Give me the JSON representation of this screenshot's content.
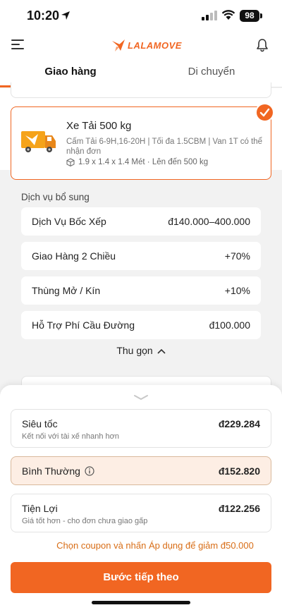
{
  "status_bar": {
    "time": "10:20",
    "battery": "98"
  },
  "header": {
    "logo_text": "LALAMOVE",
    "brand_color": "#f16622"
  },
  "tabs": [
    {
      "label": "Giao hàng",
      "active": true
    },
    {
      "label": "Di chuyển",
      "active": false
    }
  ],
  "vehicle": {
    "title": "Xe Tải 500 kg",
    "description": "Cấm Tải 6-9H,16-20H | Tối đa 1.5CBM | Van 1T có thể nhận đơn",
    "dimensions": "1.9 x 1.4 x 1.4 Mét · Lên đến 500 kg",
    "selected": true
  },
  "services": {
    "title": "Dịch vụ bổ sung",
    "items": [
      {
        "name": "Dịch Vụ Bốc Xếp",
        "price": "đ140.000–400.000"
      },
      {
        "name": "Giao Hàng 2 Chiều",
        "price": "+70%"
      },
      {
        "name": "Thùng Mở / Kín",
        "price": "+10%"
      },
      {
        "name": "Hỗ Trợ Phí Cầu Đường",
        "price": "đ100.000"
      }
    ],
    "collapse_label": "Thu gọn"
  },
  "delivery_options": [
    {
      "name": "Siêu tốc",
      "price": "đ229.284",
      "subtitle": "Kết nối với tài xế nhanh hơn",
      "selected": false
    },
    {
      "name": "Bình Thường",
      "price": "đ152.820",
      "subtitle": "",
      "selected": true
    },
    {
      "name": "Tiện Lợi",
      "price": "đ122.256",
      "subtitle": "Giá tốt hơn - cho đơn chưa giao gấp",
      "selected": false
    }
  ],
  "coupon_text": "Chọn coupon và nhấn Áp dụng để giảm đ50.000",
  "next_button": "Bước tiếp theo"
}
